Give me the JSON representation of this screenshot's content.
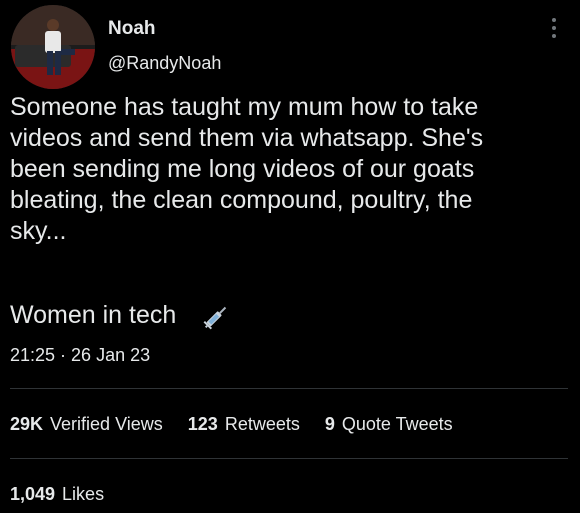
{
  "author": {
    "display_name": "Noah",
    "handle": "@RandyNoah"
  },
  "tweet": {
    "text": "Someone has taught my mum how to take\nvideos and send them via whatsapp. She's\nbeen sending me long videos of our goats\nbleating, the clean compound, poultry, the\nsky...",
    "tag_line": "Women in tech",
    "emoji_icon": "syringe-icon",
    "timestamp": "21:25 · 26 Jan 23"
  },
  "stats": {
    "views_count": "29K",
    "views_label": "Verified Views",
    "retweets_count": "123",
    "retweets_label": "Retweets",
    "quotes_count": "9",
    "quotes_label": "Quote Tweets",
    "likes_count": "1,049",
    "likes_label": "Likes"
  },
  "colors": {
    "background": "#000000",
    "text": "#e7e9ea",
    "divider": "#2f3336"
  }
}
